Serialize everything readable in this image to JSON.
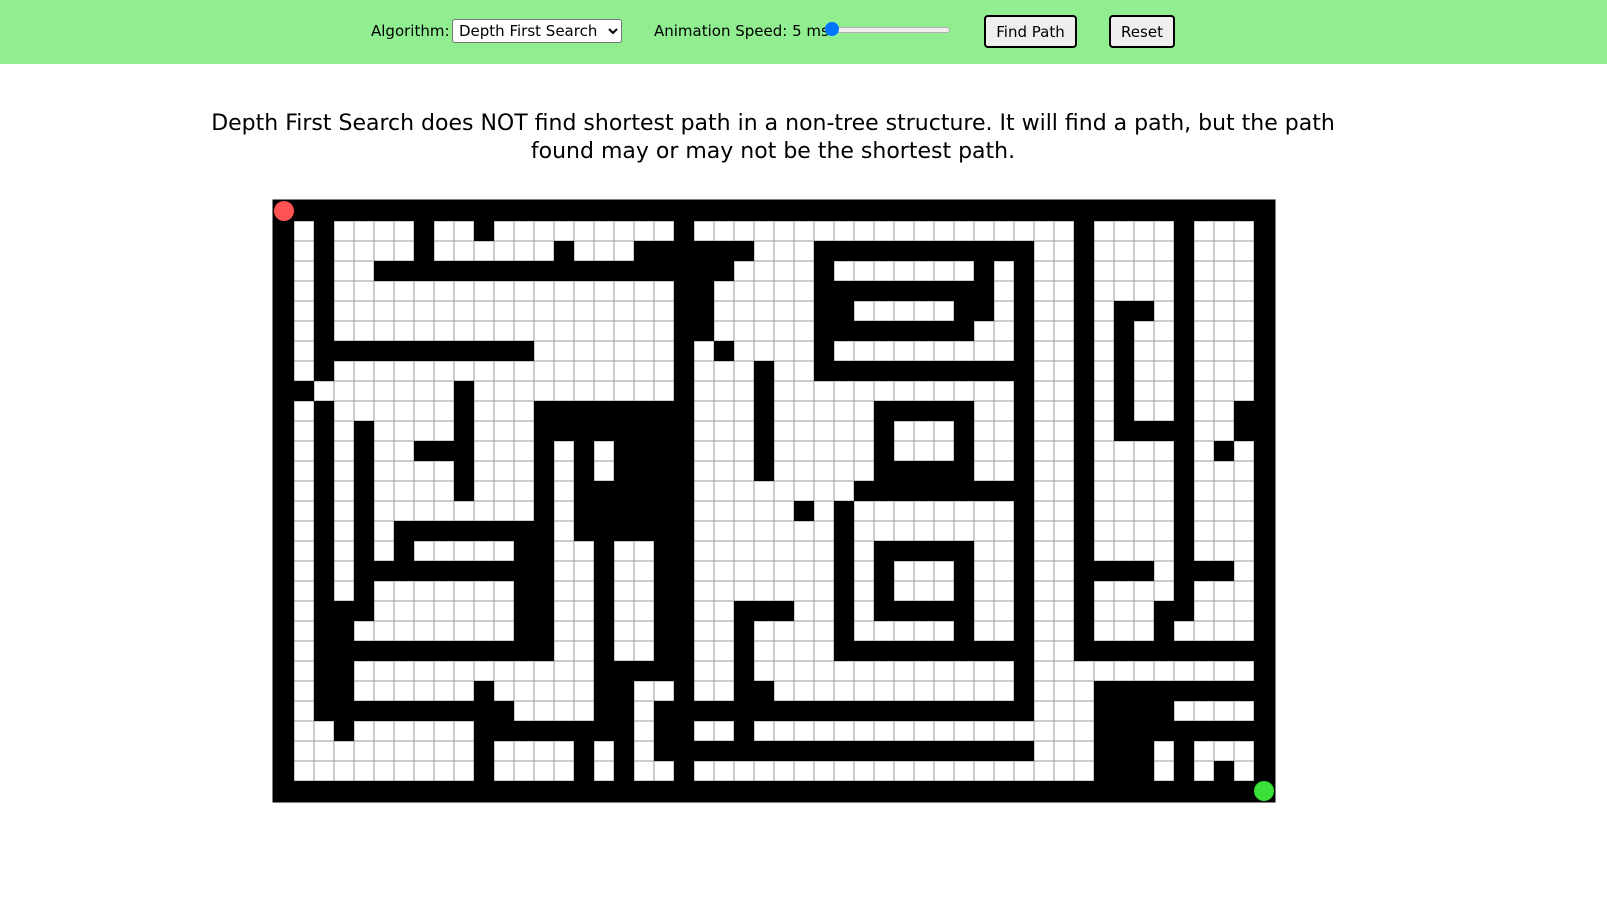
{
  "toolbar": {
    "algorithm_label": "Algorithm:",
    "algorithm_selected": "Depth First Search",
    "speed_label": "Animation Speed: 5 ms",
    "speed_value": 5,
    "find_path_label": "Find Path",
    "reset_label": "Reset",
    "background_color": "#90ee90"
  },
  "description": "Depth First Search does NOT find shortest path in a non-tree structure. It will find a path, but the path found may or may not be the shortest path.",
  "maze": {
    "columns": 50,
    "rows": 30,
    "wall_color": "#000000",
    "cell_color": "#ffffff",
    "grid_line_color": "#9a9a9a",
    "start": {
      "row": 0,
      "col": 0,
      "color": "#ff5252"
    },
    "end": {
      "row": 29,
      "col": 49,
      "color": "#38e038"
    },
    "walls": [
      [
        2,
        0,
        29
      ],
      [
        0,
        1,
        4
      ],
      [
        4,
        1,
        15
      ],
      [
        27,
        1,
        14
      ],
      [
        34,
        1,
        14
      ],
      [
        40,
        1,
        7
      ],
      [
        41,
        1,
        3
      ],
      [
        15,
        2,
        6
      ],
      [
        39,
        2,
        24
      ],
      [
        13,
        3,
        13
      ],
      [
        5,
        4,
        14
      ],
      [
        11,
        4,
        7
      ],
      [
        13,
        4,
        12
      ],
      [
        15,
        4,
        8
      ],
      [
        43,
        4,
        7
      ],
      [
        5,
        5,
        14
      ],
      [
        13,
        5,
        8
      ],
      [
        42,
        4,
        11
      ],
      [
        2,
        8,
        37
      ],
      [
        25,
        8,
        10
      ],
      [
        38,
        8,
        37
      ],
      [
        26,
        9,
        27
      ],
      [
        26,
        10,
        26
      ],
      [
        2,
        10,
        28
      ],
      [
        16,
        11,
        15
      ],
      [
        31,
        11,
        21
      ],
      [
        30,
        13,
        37
      ],
      [
        43,
        13,
        25
      ],
      [
        44,
        13,
        28
      ],
      [
        45,
        13,
        19
      ],
      [
        48,
        13,
        14
      ],
      [
        47,
        14,
        16
      ],
      [
        31,
        14,
        16
      ],
      [
        29,
        15,
        31
      ],
      [
        29,
        16,
        31
      ],
      [
        9,
        16,
        27
      ],
      [
        10,
        15,
        18
      ],
      [
        15,
        17,
        15
      ],
      [
        17,
        17,
        17
      ],
      [
        41,
        16,
        29
      ],
      [
        18,
        19,
        23
      ],
      [
        7,
        17,
        25
      ],
      [
        5,
        18,
        20
      ],
      [
        5,
        20,
        12
      ],
      [
        12,
        19,
        22
      ],
      [
        10,
        21,
        21
      ],
      [
        26,
        21,
        26
      ],
      [
        30,
        21,
        37
      ],
      [
        41,
        21,
        23
      ],
      [
        45,
        21,
        27
      ],
      [
        33,
        22,
        35
      ],
      [
        44,
        19,
        23
      ],
      [
        40,
        23,
        47
      ],
      [
        26,
        25,
        26
      ],
      [
        33,
        23,
        36
      ],
      [
        29,
        26,
        38
      ],
      [
        26,
        27,
        29
      ],
      [
        48,
        27,
        49
      ],
      [
        24,
        28,
        26
      ],
      [
        21,
        29,
        23
      ]
    ],
    "wall_rects": [
      [
        0,
        0,
        1,
        30
      ],
      [
        0,
        29,
        50,
        1
      ],
      [
        0,
        0,
        50,
        1
      ],
      [
        49,
        0,
        1,
        30
      ],
      [
        2,
        0,
        1,
        9
      ],
      [
        2,
        10,
        1,
        15
      ],
      [
        2,
        25,
        1,
        1
      ],
      [
        1,
        9,
        1,
        1
      ],
      [
        3,
        7,
        10,
        1
      ],
      [
        2,
        7,
        1,
        1
      ],
      [
        19,
        0,
        3,
        1
      ],
      [
        20,
        0,
        1,
        2
      ],
      [
        18,
        2,
        6,
        1
      ],
      [
        16,
        3,
        7,
        1
      ],
      [
        13,
        3,
        3,
        1
      ],
      [
        14,
        2,
        1,
        2
      ],
      [
        10,
        0,
        1,
        2
      ],
      [
        7,
        1,
        1,
        3
      ],
      [
        5,
        3,
        9,
        1
      ],
      [
        21,
        3,
        1,
        4
      ],
      [
        22,
        7,
        1,
        1
      ],
      [
        20,
        5,
        1,
        24
      ],
      [
        9,
        9,
        1,
        6
      ],
      [
        7,
        12,
        3,
        1
      ],
      [
        6,
        16,
        8,
        1
      ],
      [
        6,
        16,
        1,
        2
      ],
      [
        12,
        16,
        1,
        7
      ],
      [
        13,
        17,
        1,
        6
      ],
      [
        4,
        11,
        1,
        10
      ],
      [
        3,
        20,
        2,
        1
      ],
      [
        3,
        21,
        1,
        6
      ],
      [
        4,
        22,
        10,
        1
      ],
      [
        4,
        18,
        9,
        1
      ],
      [
        3,
        25,
        9,
        1
      ],
      [
        10,
        24,
        1,
        5
      ],
      [
        11,
        25,
        1,
        1
      ],
      [
        2,
        25,
        8,
        1
      ],
      [
        13,
        10,
        1,
        8
      ],
      [
        14,
        11,
        1,
        1
      ],
      [
        14,
        10,
        5,
        1
      ],
      [
        15,
        11,
        4,
        1
      ],
      [
        15,
        12,
        1,
        5
      ],
      [
        17,
        12,
        1,
        4
      ],
      [
        18,
        12,
        1,
        4
      ],
      [
        15,
        15,
        4,
        1
      ],
      [
        16,
        14,
        1,
        1
      ],
      [
        15,
        16,
        4,
        1
      ],
      [
        16,
        17,
        1,
        8
      ],
      [
        17,
        24,
        1,
        1
      ],
      [
        16,
        23,
        4,
        1
      ],
      [
        18,
        23,
        1,
        1
      ],
      [
        19,
        10,
        1,
        13
      ],
      [
        20,
        22,
        1,
        2
      ],
      [
        16,
        25,
        2,
        1
      ],
      [
        17,
        26,
        1,
        3
      ],
      [
        14,
        26,
        3,
        1
      ],
      [
        20,
        4,
        2,
        1
      ],
      [
        24,
        8,
        1,
        6
      ],
      [
        27,
        2,
        10,
        1
      ],
      [
        27,
        3,
        1,
        5
      ],
      [
        28,
        4,
        7,
        1
      ],
      [
        28,
        5,
        1,
        2
      ],
      [
        28,
        6,
        7,
        1
      ],
      [
        34,
        4,
        1,
        3
      ],
      [
        35,
        2,
        1,
        4
      ],
      [
        37,
        2,
        1,
        8
      ],
      [
        27,
        8,
        11,
        1
      ],
      [
        30,
        10,
        5,
        1
      ],
      [
        30,
        11,
        1,
        4
      ],
      [
        31,
        13,
        4,
        1
      ],
      [
        34,
        11,
        1,
        3
      ],
      [
        29,
        14,
        9,
        1
      ],
      [
        26,
        15,
        1,
        1
      ],
      [
        28,
        15,
        1,
        8
      ],
      [
        28,
        22,
        9,
        1
      ],
      [
        30,
        17,
        1,
        4
      ],
      [
        30,
        17,
        5,
        1
      ],
      [
        34,
        17,
        1,
        5
      ],
      [
        30,
        20,
        4,
        1
      ],
      [
        24,
        20,
        2,
        1
      ],
      [
        23,
        20,
        1,
        4
      ],
      [
        23,
        21,
        1,
        1
      ],
      [
        23,
        24,
        2,
        1
      ],
      [
        23,
        26,
        1,
        1
      ],
      [
        37,
        10,
        1,
        16
      ],
      [
        19,
        25,
        19,
        1
      ],
      [
        19,
        26,
        1,
        2
      ],
      [
        19,
        27,
        19,
        1
      ],
      [
        40,
        0,
        1,
        23
      ],
      [
        40,
        0,
        2,
        1
      ],
      [
        41,
        18,
        3,
        1
      ],
      [
        46,
        18,
        2,
        1
      ],
      [
        42,
        5,
        1,
        7
      ],
      [
        42,
        5,
        2,
        1
      ],
      [
        42,
        11,
        3,
        1
      ],
      [
        45,
        1,
        1,
        20
      ],
      [
        44,
        20,
        1,
        2
      ],
      [
        48,
        10,
        1,
        2
      ],
      [
        47,
        12,
        1,
        1
      ],
      [
        41,
        22,
        8,
        1
      ],
      [
        41,
        24,
        1,
        5
      ],
      [
        42,
        24,
        1,
        5
      ],
      [
        43,
        24,
        1,
        5
      ],
      [
        44,
        24,
        5,
        1
      ],
      [
        44,
        24,
        1,
        3
      ],
      [
        45,
        26,
        4,
        1
      ],
      [
        45,
        26,
        1,
        3
      ],
      [
        47,
        28,
        1,
        2
      ],
      [
        11,
        26,
        3,
        1
      ],
      [
        15,
        27,
        1,
        2
      ]
    ]
  }
}
